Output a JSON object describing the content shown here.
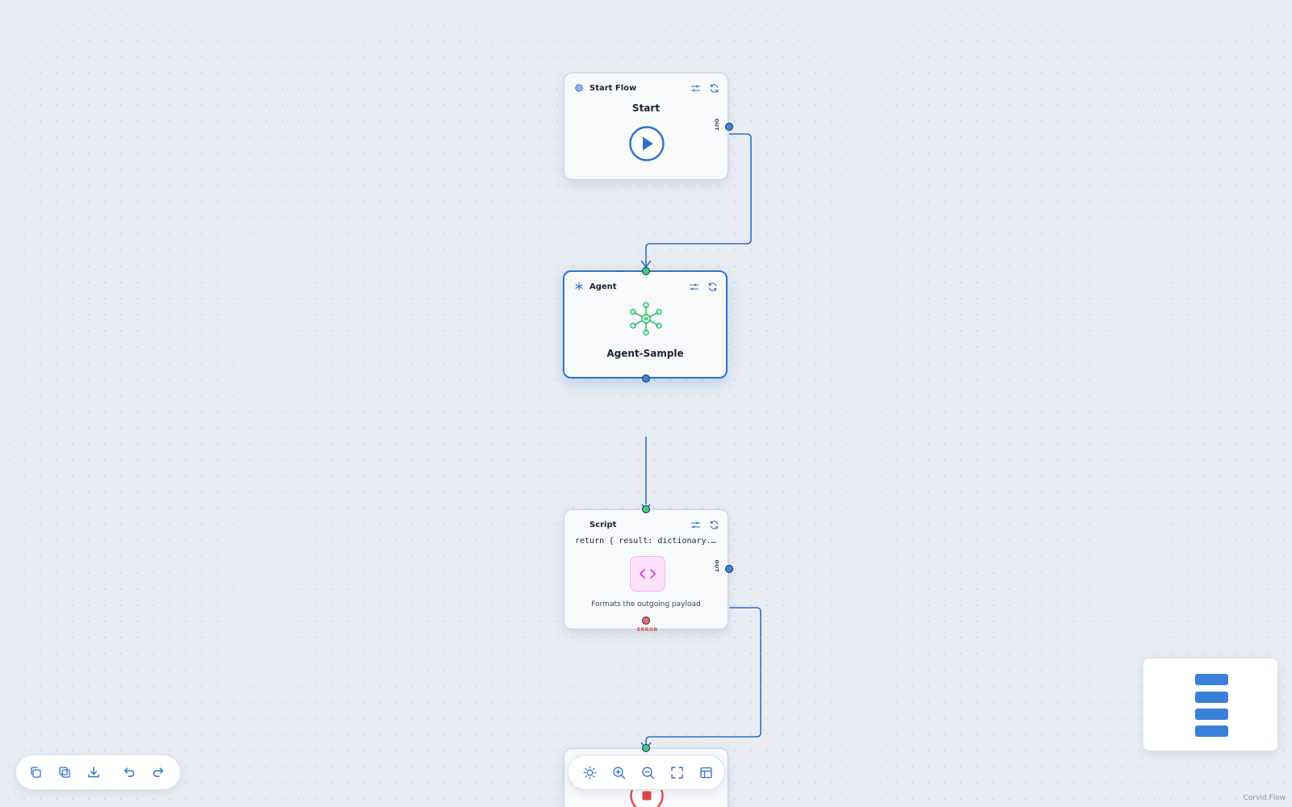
{
  "nodes": {
    "start": {
      "type_label": "Start Flow",
      "title": "Start",
      "out_label": "OUT"
    },
    "agent": {
      "type_label": "Agent",
      "title": "Agent-Sample"
    },
    "script": {
      "type_label": "Script",
      "code": "return { result: dictionary.…",
      "description": "Formats the outgoing payload",
      "out_label": "OUT",
      "error_label": "ERROR"
    },
    "end": {
      "type_label": ""
    }
  },
  "left_toolbar": {
    "buttons": [
      "copy-icon",
      "duplicate-icon",
      "download-icon",
      "undo-icon",
      "redo-icon"
    ]
  },
  "center_toolbar": {
    "buttons": [
      "theme-sun-icon",
      "zoom-in-icon",
      "zoom-out-icon",
      "fit-view-icon",
      "layout-icon"
    ]
  },
  "watermark": "Corvid Flow",
  "colors": {
    "accent": "#2f74d0",
    "port_out": "#3f84dc",
    "port_in": "#3ecf7a",
    "port_error": "#f06a6a",
    "agent_icon": "#34c46e",
    "script_icon": "#d148cc",
    "end_icon": "#e04848"
  }
}
